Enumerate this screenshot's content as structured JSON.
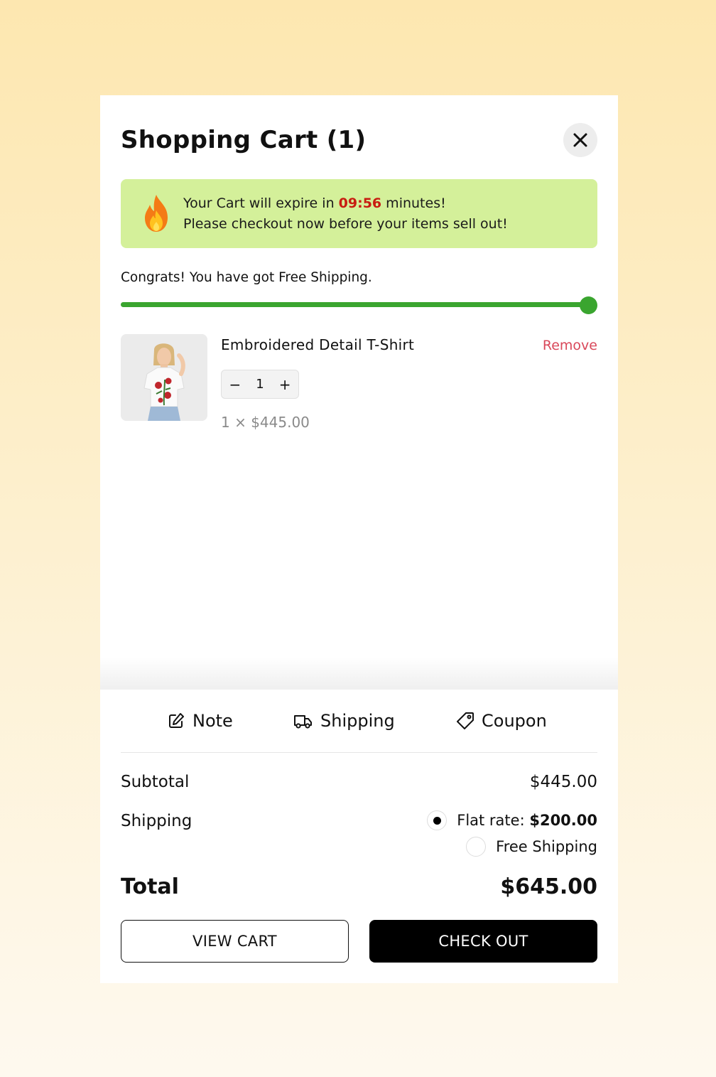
{
  "cart": {
    "title": "Shopping Cart (1)",
    "close_icon": "close-icon"
  },
  "expire": {
    "icon": "fire-icon",
    "line1_prefix": "Your Cart will expire in ",
    "timer": "09:56",
    "line1_suffix": " minutes!",
    "line2": "Please checkout now before your items sell out!"
  },
  "shipping_progress": {
    "message": "Congrats! You have got Free Shipping.",
    "percent": 100,
    "color": "#3aa52f"
  },
  "item": {
    "name": "Embroidered Detail T-Shirt",
    "remove_label": "Remove",
    "quantity": "1",
    "minus": "−",
    "plus": "+",
    "line_price": "1 × $445.00",
    "image_icon": "product-thumbnail"
  },
  "tabs": [
    {
      "label": "Note",
      "icon": "edit-icon"
    },
    {
      "label": "Shipping",
      "icon": "truck-icon"
    },
    {
      "label": "Coupon",
      "icon": "tag-icon"
    }
  ],
  "summary": {
    "subtotal_label": "Subtotal",
    "subtotal_value": "$445.00",
    "shipping_label": "Shipping",
    "shipping_options": [
      {
        "label": "Flat rate: ",
        "price": "$200.00",
        "selected": true
      },
      {
        "label": "Free Shipping",
        "price": "",
        "selected": false
      }
    ],
    "total_label": "Total",
    "total_value": "$645.00"
  },
  "buttons": {
    "view_cart": "VIEW CART",
    "check_out": "CHECK OUT"
  },
  "colors": {
    "accent_green": "#3aa52f",
    "banner_bg": "#d4f09a",
    "timer_red": "#c81d11",
    "remove_red": "#d9485a"
  }
}
